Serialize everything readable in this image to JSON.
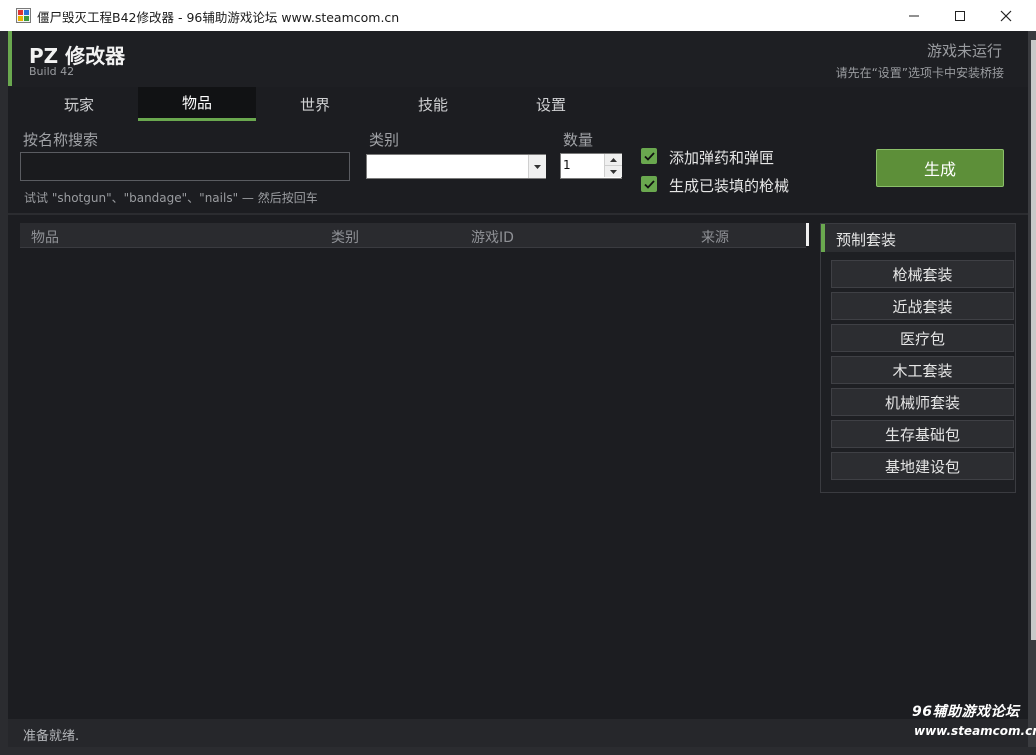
{
  "window": {
    "title": "僵尸毁灭工程B42修改器 - 96辅助游戏论坛 www.steamcom.cn"
  },
  "header": {
    "app_name": "PZ 修改器",
    "build": "Build 42",
    "status_main": "游戏未运行",
    "status_sub": "请先在“设置”选项卡中安装桥接"
  },
  "tabs": [
    {
      "label": "玩家",
      "active": false
    },
    {
      "label": "物品",
      "active": true
    },
    {
      "label": "世界",
      "active": false
    },
    {
      "label": "技能",
      "active": false
    },
    {
      "label": "设置",
      "active": false
    }
  ],
  "toolbar": {
    "search_label": "按名称搜索",
    "search_value": "",
    "search_hint": "试试 \"shotgun\"、\"bandage\"、\"nails\" — 然后按回车",
    "category_label": "类别",
    "category_value": "",
    "quantity_label": "数量",
    "quantity_value": "1",
    "checkbox_ammo": {
      "label": "添加弹药和弹匣",
      "checked": true
    },
    "checkbox_loaded": {
      "label": "生成已装填的枪械",
      "checked": true
    },
    "generate_label": "生成"
  },
  "table": {
    "columns": [
      "物品",
      "类别",
      "游戏ID",
      "来源"
    ],
    "rows": []
  },
  "presets": {
    "title": "预制套装",
    "items": [
      "枪械套装",
      "近战套装",
      "医疗包",
      "木工套装",
      "机械师套装",
      "生存基础包",
      "基地建设包"
    ]
  },
  "statusbar": {
    "text": "准备就绪."
  },
  "watermark": {
    "line1": "96辅助游戏论坛",
    "line2": "www.steamcom.cn"
  },
  "colors": {
    "accent": "#6aa84f",
    "background": "#1c1d21",
    "button_green": "#5d8f39"
  }
}
